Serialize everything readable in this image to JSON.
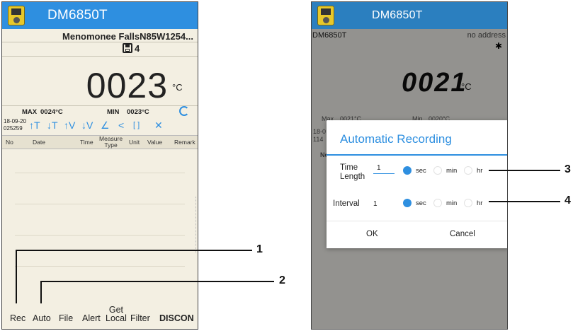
{
  "left_phone": {
    "app_title": "DM6850T",
    "location": "Menomonee FallsN85W1254...",
    "save_count": "4",
    "reading": "0023",
    "unit": "°C",
    "stats": {
      "max_label": "MAX",
      "max_value": "0024°C",
      "min_label": "MIN",
      "min_value": "0023°C"
    },
    "timestamp_line1": "18-09-20",
    "timestamp_line2": "025259",
    "toolbar_icons": [
      "↑T",
      "↓T",
      "↑V",
      "↓V",
      "∠",
      "<",
      "[ ]",
      "✕"
    ],
    "table_headers": {
      "no": "No",
      "date": "Date",
      "time": "Time",
      "measure_type_1": "Measure",
      "measure_type_2": "Type",
      "unit": "Unit",
      "value": "Value",
      "remark": "Remark"
    },
    "bottom_bar": {
      "rec": "Rec",
      "auto": "Auto",
      "file": "File",
      "alert": "Alert",
      "get_local_1": "Get",
      "get_local_2": "Local",
      "filter": "Filter",
      "discon": "DISCON"
    }
  },
  "right_phone": {
    "app_title": "DM6850T",
    "device_name": "DM6850T",
    "address": "no address",
    "reading": "0021",
    "unit": "°C",
    "ghost": {
      "max": "Max",
      "max_value": "0021°C",
      "min": "Min",
      "min_value": "0020°C",
      "ts1": "18-0",
      "ts2": "114",
      "no": "No",
      "rk": "rk"
    },
    "dialog": {
      "title": "Automatic Recording",
      "time_length_label_1": "Time",
      "time_length_label_2": "Length",
      "time_length_value": "1",
      "interval_label": "Interval",
      "interval_value": "1",
      "options": [
        "sec",
        "min",
        "hr"
      ],
      "time_length_selected": "sec",
      "interval_selected": "sec",
      "ok": "OK",
      "cancel": "Cancel"
    }
  },
  "callouts": [
    "1",
    "2",
    "3",
    "4"
  ],
  "colors": {
    "accent": "#2e8fe0",
    "appbar_left": "#2e8fe0",
    "appbar_right": "#2b7fbf",
    "left_bg": "#f3efe2"
  }
}
